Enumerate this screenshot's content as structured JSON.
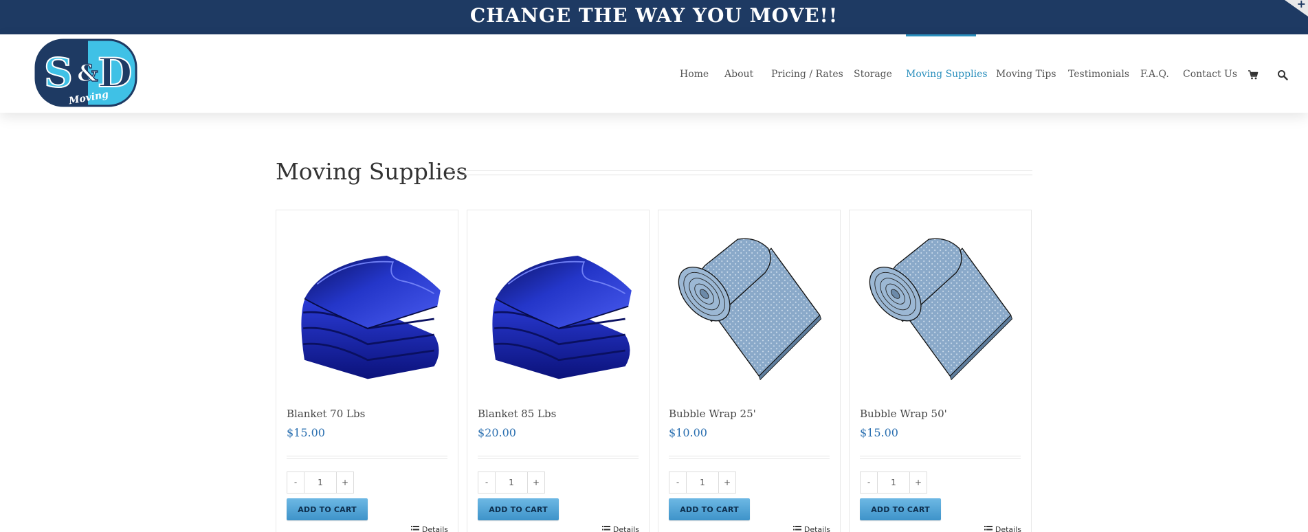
{
  "banner": {
    "text": "CHANGE THE WAY YOU MOVE!!",
    "toggle": "+"
  },
  "logo": {
    "text_s": "S",
    "text_amp": "&",
    "text_d": "D",
    "script": "Moving"
  },
  "nav": {
    "items": [
      {
        "label": "Home"
      },
      {
        "label": "About"
      },
      {
        "label": "Pricing / Rates"
      },
      {
        "label": "Storage"
      },
      {
        "label": "Moving Supplies"
      },
      {
        "label": "Moving Tips"
      },
      {
        "label": "Testimonials"
      },
      {
        "label": "F.A.Q."
      },
      {
        "label": "Contact Us"
      }
    ],
    "active": "Moving Supplies",
    "icons": [
      "cart-icon",
      "search-icon"
    ]
  },
  "page": {
    "title": "Moving Supplies"
  },
  "products": [
    {
      "name": "Blanket 70 Lbs",
      "price": "$15.00",
      "qty": "1",
      "add_label": "ADD TO CART",
      "details_label": "Details",
      "image": "blanket"
    },
    {
      "name": "Blanket 85 Lbs",
      "price": "$20.00",
      "qty": "1",
      "add_label": "ADD TO CART",
      "details_label": "Details",
      "image": "blanket"
    },
    {
      "name": "Bubble Wrap 25'",
      "price": "$10.00",
      "qty": "1",
      "add_label": "ADD TO CART",
      "details_label": "Details",
      "image": "bubble-wrap"
    },
    {
      "name": "Bubble Wrap 50'",
      "price": "$15.00",
      "qty": "1",
      "add_label": "ADD TO CART",
      "details_label": "Details",
      "image": "bubble-wrap"
    }
  ],
  "qty_controls": {
    "minus": "-",
    "plus": "+"
  },
  "colors": {
    "banner": "#1e3a63",
    "accent": "#2a8fbd",
    "price": "#2a6fb0",
    "button": "#4fa3d6",
    "blanket": "#1f2fbf",
    "bubble": "#8aa9c9"
  }
}
